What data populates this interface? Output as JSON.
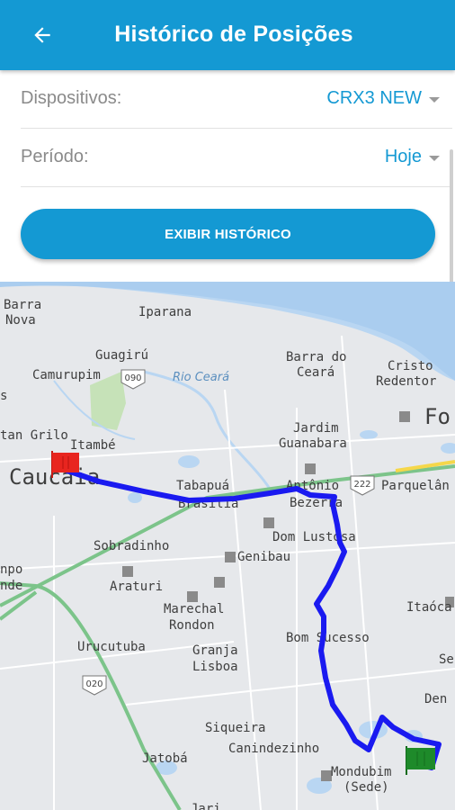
{
  "appbar": {
    "title": "Histórico de Posições",
    "back_icon": "arrow-left-icon"
  },
  "form": {
    "device_label": "Dispositivos:",
    "device_value": "CRX3 NEW",
    "period_label": "Período:",
    "period_value": "Hoje",
    "button_label": "EXIBIR HISTÓRICO"
  },
  "map": {
    "labels": {
      "barra_nova_1": "Barra",
      "barra_nova_2": "Nova",
      "iparana": "Iparana",
      "guagiru": "Guagirú",
      "camurupim": "Camurupim",
      "road_090": "090",
      "rio_ceara": "Rio Ceará",
      "barra_ceara_1": "Barra do",
      "barra_ceara_2": "Ceará",
      "cristo_1": "Cristo",
      "cristo_2": "Redentor",
      "s": "s",
      "fo": "Fo",
      "jardim_1": "Jardim",
      "jardim_2": "Guanabara",
      "tan_grilo": "tan Grilo",
      "itambe": "Itambé",
      "caucaia": "Caucaia",
      "tabapua": "Tabapuá",
      "brasilia": "Brasília",
      "antonio_1": "Antônio",
      "antonio_2": "Bezerra",
      "road_222": "222",
      "parquelandia": "Parquelân",
      "dom_lustosa": "Dom Lustosa",
      "sobradinho": "Sobradinho",
      "genibau": "Genibau",
      "npo_1": "npo",
      "npo_2": "nde",
      "araturi": "Araturi",
      "marechal_1": "Marechal",
      "marechal_2": "Rondon",
      "itaoca": "Itaóca",
      "bom_sucesso": "Bom Sucesso",
      "urucutuba": "Urucutuba",
      "granja_1": "Granja",
      "granja_2": "Lisboa",
      "se": "Se",
      "road_020": "020",
      "den": "Den",
      "siqueira": "Siqueira",
      "canindezinho": "Canindezinho",
      "jatoba": "Jatobá",
      "mondubim_1": "Mondubim",
      "mondubim_2": "(Sede)",
      "jari": "Jari"
    },
    "route_color": "#1a1af0",
    "start_flag_color": "#e8251f",
    "end_flag_color": "#1e8a2a"
  }
}
